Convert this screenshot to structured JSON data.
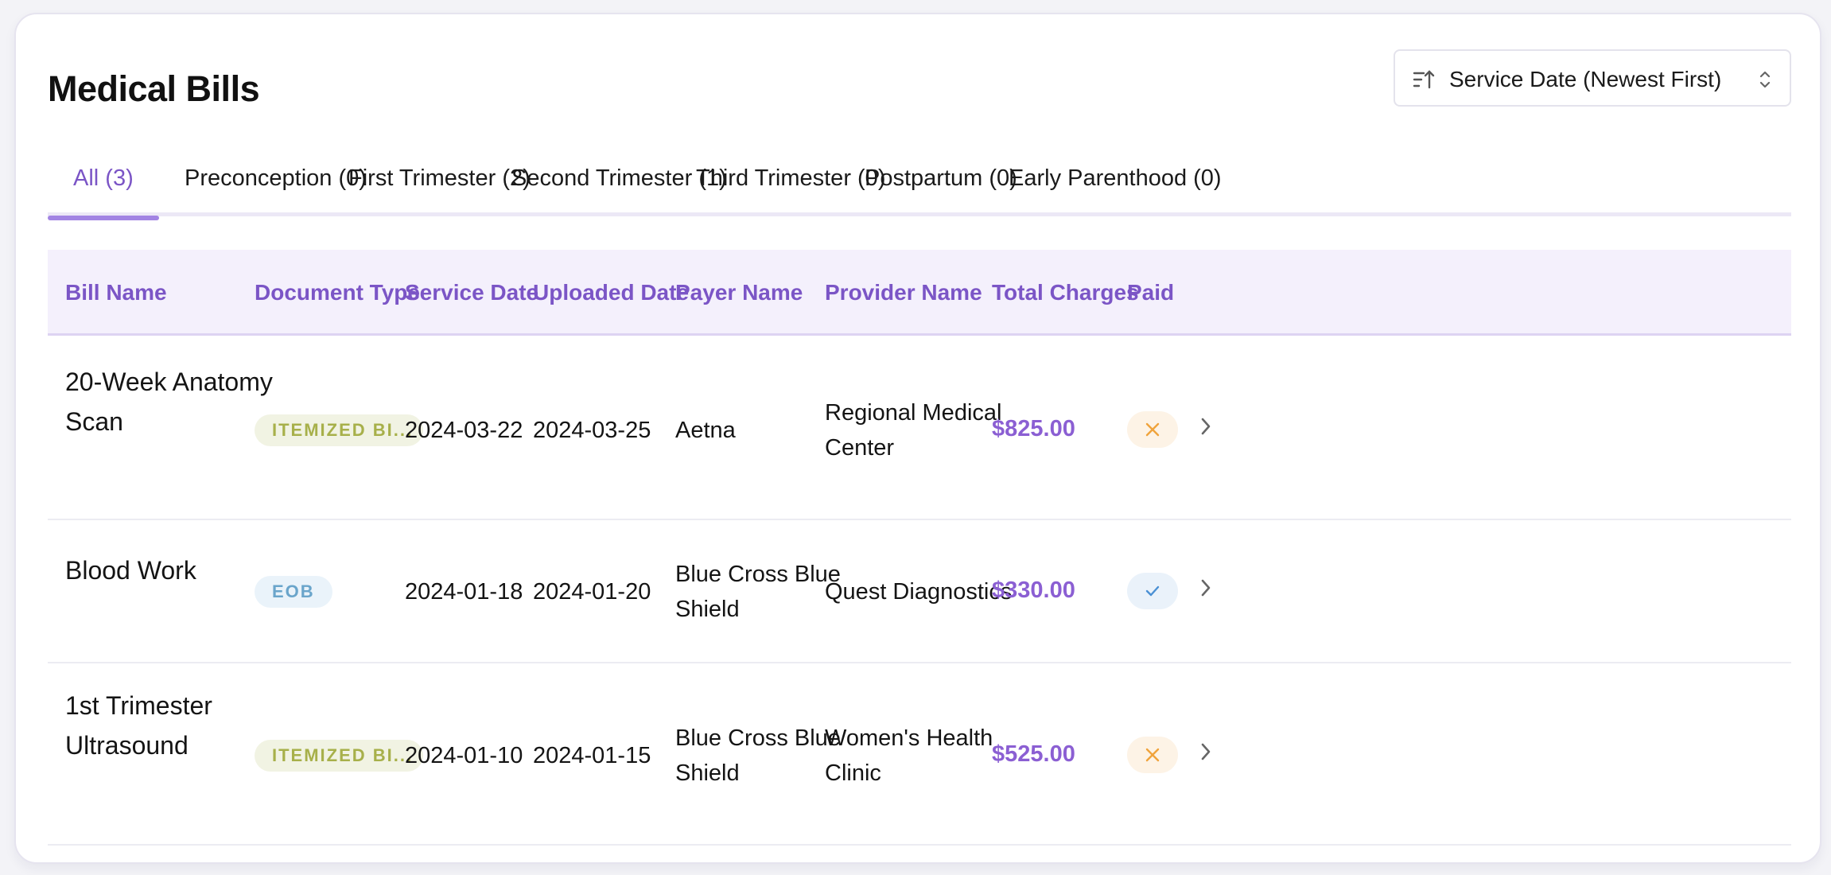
{
  "page": {
    "title": "Medical Bills",
    "sort": {
      "icon": "sort-ascending-icon",
      "label": "Service Date (Newest First)",
      "dropdown_icon": "chevron-up-down-icon"
    }
  },
  "tabs": [
    {
      "label": "All (3)",
      "active": true
    },
    {
      "label": "Preconception (0)",
      "active": false
    },
    {
      "label": "First Trimester (2)",
      "active": false
    },
    {
      "label": "Second Trimester (1)",
      "active": false
    },
    {
      "label": "Third Trimester (0)",
      "active": false
    },
    {
      "label": "Postpartum (0)",
      "active": false
    },
    {
      "label": "Early Parenthood (0)",
      "active": false
    }
  ],
  "table": {
    "columns": [
      "Bill Name",
      "Document Type",
      "Service Date",
      "Uploaded Date",
      "Payer Name",
      "Provider Name",
      "Total Charges",
      "Paid"
    ],
    "rows": [
      {
        "bill_name": [
          "20-Week Anatomy",
          "Scan"
        ],
        "document_type": "ITEMIZED BI...",
        "service_date": "2024-03-22",
        "uploaded_date": "2024-03-25",
        "payer_name": [
          "Aetna"
        ],
        "provider_name": [
          "Regional Medical",
          "Center"
        ],
        "total_charges": "$825.00",
        "paid": false
      },
      {
        "bill_name": [
          "Blood Work"
        ],
        "document_type": "EOB",
        "service_date": "2024-01-18",
        "uploaded_date": "2024-01-20",
        "payer_name": [
          "Blue Cross Blue",
          "Shield"
        ],
        "provider_name": [
          "Quest Diagnostics"
        ],
        "total_charges": "$330.00",
        "paid": true
      },
      {
        "bill_name": [
          "1st Trimester",
          "Ultrasound"
        ],
        "document_type": "ITEMIZED BI...",
        "service_date": "2024-01-10",
        "uploaded_date": "2024-01-15",
        "payer_name": [
          "Blue Cross Blue",
          "Shield"
        ],
        "provider_name": [
          "Women's Health",
          "Clinic"
        ],
        "total_charges": "$525.00",
        "paid": false
      }
    ]
  },
  "colors": {
    "accent": "#7b55c6",
    "charge": "#8b5fd3",
    "header_bg": "#f4f0fc",
    "unpaid_icon": "#f0a33c",
    "paid_icon": "#4a90d4",
    "itemized_badge_text": "#a7b04a",
    "eob_badge_text": "#6aa5cb"
  }
}
